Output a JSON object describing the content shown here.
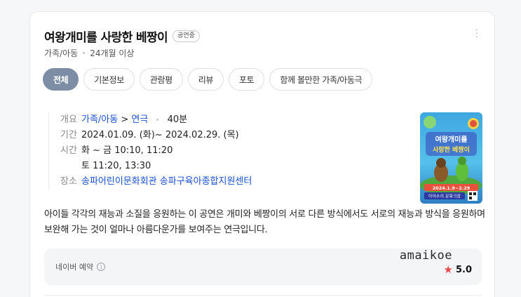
{
  "header": {
    "title": "여왕개미를 사랑한 베짱이",
    "badge": "공연중",
    "more_icon": "⋮",
    "genre": "가족/아동",
    "age": "24개월 이상"
  },
  "tabs": [
    {
      "label": "전체",
      "active": true
    },
    {
      "label": "기본정보",
      "active": false
    },
    {
      "label": "관람평",
      "active": false
    },
    {
      "label": "리뷰",
      "active": false
    },
    {
      "label": "포토",
      "active": false
    },
    {
      "label": "함께 볼만한 가족/아동극",
      "active": false
    }
  ],
  "info": {
    "overview_label": "개요",
    "overview_genre": "가족/아동",
    "overview_arrow": ">",
    "overview_type": "연극",
    "overview_runtime": "40분",
    "period_label": "기간",
    "period_value": "2024.01.09. (화)~ 2024.02.29. (목)",
    "time_label": "시간",
    "time_line1": "화 ~ 금 10:10, 11:20",
    "time_line2": "토 11:20, 13:30",
    "venue_label": "장소",
    "venue_value": "송파어린이문화회관 송파구육아종합지원센터"
  },
  "poster": {
    "title_line1": "여왕개미를",
    "title_line2": "사랑한 베짱이",
    "date_text": "2024.1.9~2.29",
    "venue_text": "아이소리 문화극장"
  },
  "description": "아이들 각각의 재능과 소질을 응원하는 이 공연은 개미와 베짱이의 서로 다른 방식에서도 서로의 재능과 방식을 응원하며 보완해 가는 것이 얼마나 아름다운가를 보여주는 연극입니다.",
  "review": {
    "label": "네이버 예약",
    "info_icon": "i",
    "author": "amaikoe",
    "star": "★",
    "rating": "5.0"
  },
  "colors": {
    "active_tab": "#7e8da6",
    "link": "#1a4fd6",
    "star": "#e74848"
  }
}
